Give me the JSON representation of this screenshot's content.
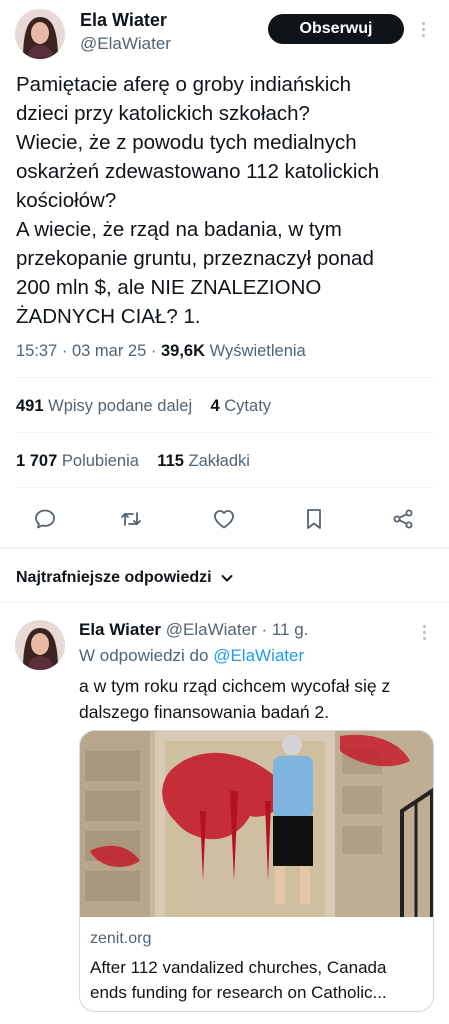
{
  "tweet": {
    "author_name": "Ela Wiater",
    "author_handle": "@ElaWiater",
    "follow_label": "Obserwuj",
    "text_lines": [
      "Pamiętacie aferę o groby indiańskich",
      "dzieci przy katolickich szkołach?",
      "Wiecie, że z powodu tych medialnych",
      "oskarżeń zdewastowano 112  katolickich",
      "kościołów?",
      "A wiecie, że rząd na badania, w tym",
      "przekopanie gruntu, przeznaczył ponad",
      "200 mln $, ale NIE ZNALEZIONO",
      "ŻADNYCH CIAŁ? 1."
    ],
    "time": "15:37",
    "date": "03 mar 25",
    "views_count": "39,6K",
    "views_label": "Wyświetlenia",
    "reposts_count": "491",
    "reposts_label": "Wpisy podane dalej",
    "quotes_count": "4",
    "quotes_label": "Cytaty",
    "likes_count": "1 707",
    "likes_label": "Polubienia",
    "bookmarks_count": "115",
    "bookmarks_label": "Zakładki"
  },
  "actions": {
    "icons": [
      "reply-icon",
      "retweet-icon",
      "like-icon",
      "bookmark-icon",
      "share-icon"
    ]
  },
  "replies_header": {
    "label": "Najtrafniejsze odpowiedzi"
  },
  "reply": {
    "author_name": "Ela Wiater",
    "author_handle": "@ElaWiater",
    "time_ago": "· 11 g.",
    "reply_to_prefix": "W odpowiedzi do",
    "reply_to_handle": "@ElaWiater",
    "text_lines": [
      "a w tym roku rząd cichcem wycofał się z",
      "dalszego finansowania badań 2."
    ],
    "card": {
      "domain": "zenit.org",
      "title_lines": [
        "After 112 vandalized churches, Canada",
        "ends funding for research on Catholic..."
      ]
    }
  },
  "colors": {
    "text": "#0f1419",
    "secondary": "#536471",
    "link": "#1d9bf0",
    "divider": "#eff3f4",
    "button": "#0f1419"
  }
}
